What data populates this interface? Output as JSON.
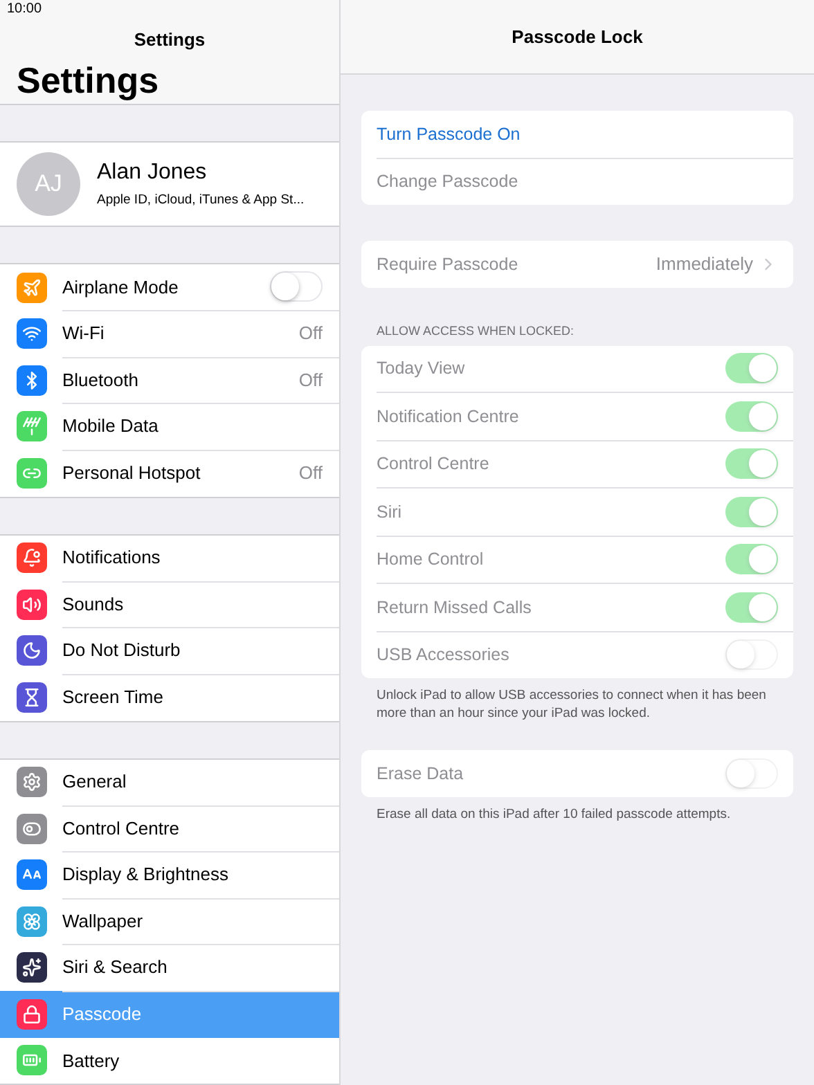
{
  "status_bar": {
    "time": "10:00"
  },
  "sidebar": {
    "nav_title": "Settings",
    "large_title": "Settings",
    "profile": {
      "initials": "AJ",
      "name": "Alan Jones",
      "subtitle": "Apple ID, iCloud, iTunes & App St..."
    },
    "groups": [
      [
        {
          "label": "Airplane Mode",
          "color": "#ff9500",
          "kind": "toggle",
          "on": false,
          "selected": false
        },
        {
          "label": "Wi-Fi",
          "color": "#147efb",
          "kind": "detail",
          "value": "Off",
          "selected": false
        },
        {
          "label": "Bluetooth",
          "color": "#147efb",
          "kind": "detail",
          "value": "Off",
          "selected": false
        },
        {
          "label": "Mobile Data",
          "color": "#4cd964",
          "kind": "detail",
          "selected": false
        },
        {
          "label": "Personal Hotspot",
          "color": "#4cd964",
          "kind": "detail",
          "value": "Off",
          "selected": false
        }
      ],
      [
        {
          "label": "Notifications",
          "color": "#ff3b30",
          "kind": "detail",
          "selected": false
        },
        {
          "label": "Sounds",
          "color": "#ff2d55",
          "kind": "detail",
          "selected": false
        },
        {
          "label": "Do Not Disturb",
          "color": "#5856d6",
          "kind": "detail",
          "selected": false
        },
        {
          "label": "Screen Time",
          "color": "#5856d6",
          "kind": "detail",
          "selected": false
        }
      ],
      [
        {
          "label": "General",
          "color": "#8e8e93",
          "kind": "detail",
          "selected": false
        },
        {
          "label": "Control Centre",
          "color": "#8e8e93",
          "kind": "detail",
          "selected": false
        },
        {
          "label": "Display & Brightness",
          "color": "#147efb",
          "kind": "detail",
          "selected": false
        },
        {
          "label": "Wallpaper",
          "color": "#34aadc",
          "kind": "detail",
          "selected": false
        },
        {
          "label": "Siri & Search",
          "color": "#2b2b4a",
          "kind": "detail",
          "selected": false
        },
        {
          "label": "Passcode",
          "color": "#ff2d55",
          "kind": "detail",
          "selected": true
        },
        {
          "label": "Battery",
          "color": "#4cd964",
          "kind": "detail",
          "selected": false
        }
      ]
    ]
  },
  "detail": {
    "title": "Passcode Lock",
    "groups": [
      {
        "rows": [
          {
            "kind": "action",
            "label": "Turn Passcode On",
            "disabled": false
          },
          {
            "kind": "action",
            "label": "Change Passcode",
            "disabled": true
          }
        ]
      },
      {
        "rows": [
          {
            "kind": "detail",
            "label": "Require Passcode",
            "value": "Immediately",
            "disabled": true
          }
        ]
      },
      {
        "header": "ALLOW ACCESS WHEN LOCKED:",
        "footer": "Unlock iPad to allow USB accessories to connect when it has been more than an hour since your iPad was locked.",
        "rows": [
          {
            "kind": "toggle",
            "label": "Today View",
            "on": true,
            "disabled": true
          },
          {
            "kind": "toggle",
            "label": "Notification Centre",
            "on": true,
            "disabled": true
          },
          {
            "kind": "toggle",
            "label": "Control Centre",
            "on": true,
            "disabled": true
          },
          {
            "kind": "toggle",
            "label": "Siri",
            "on": true,
            "disabled": true
          },
          {
            "kind": "toggle",
            "label": "Home Control",
            "on": true,
            "disabled": true
          },
          {
            "kind": "toggle",
            "label": "Return Missed Calls",
            "on": true,
            "disabled": true
          },
          {
            "kind": "toggle",
            "label": "USB Accessories",
            "on": false,
            "disabled": true
          }
        ]
      },
      {
        "footer": "Erase all data on this iPad after 10 failed passcode attempts.",
        "rows": [
          {
            "kind": "toggle",
            "label": "Erase Data",
            "on": false,
            "disabled": true
          }
        ]
      }
    ]
  }
}
